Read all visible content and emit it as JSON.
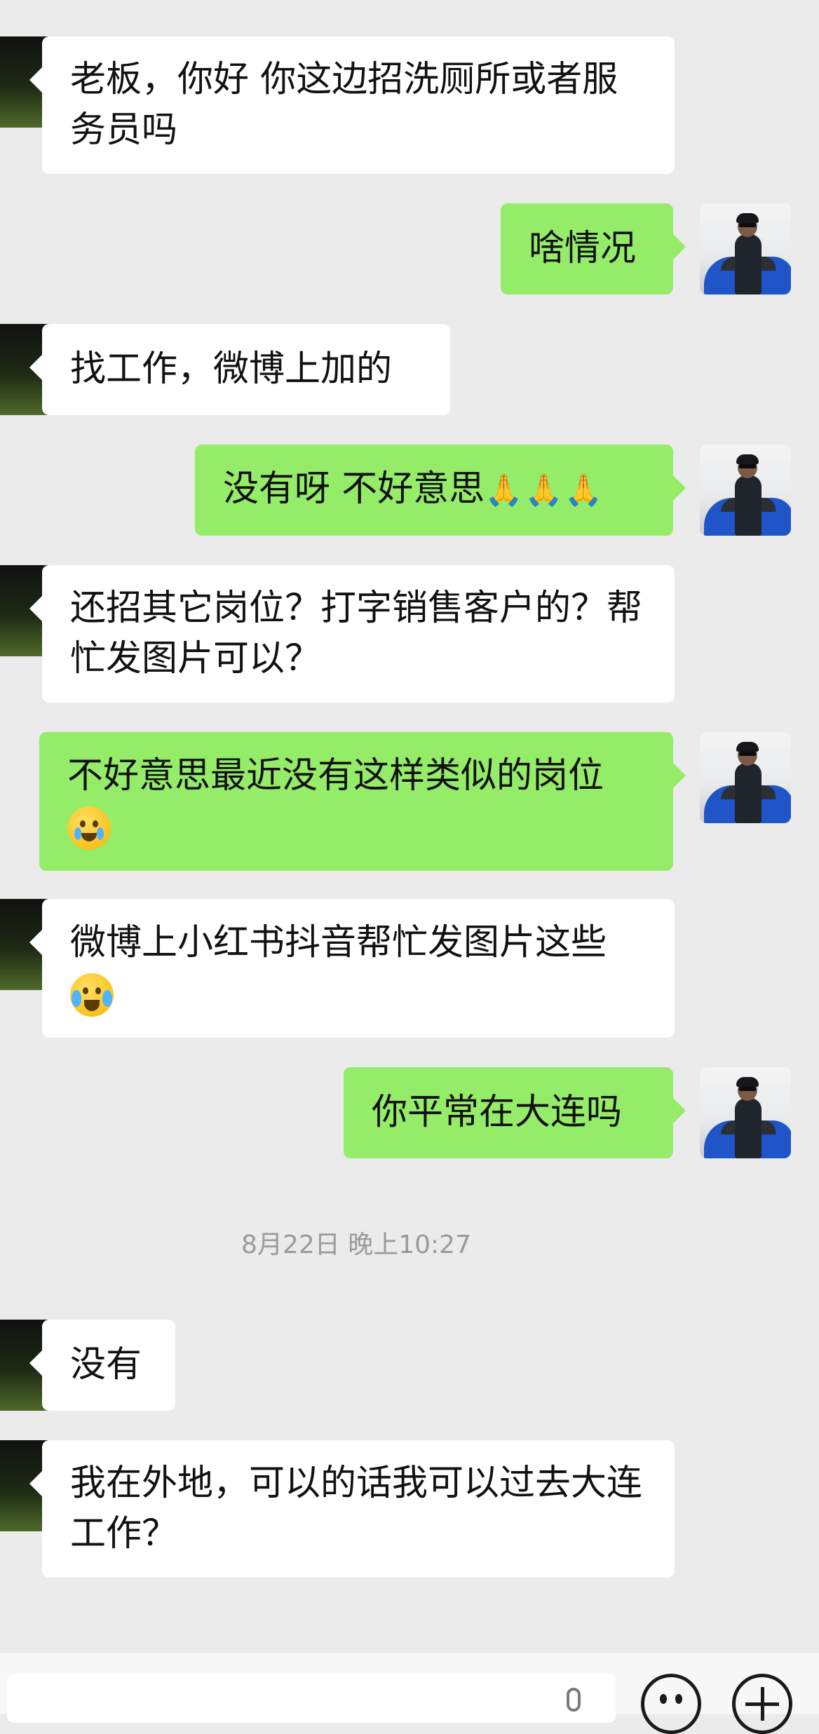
{
  "theme": {
    "background": "#ebebeb",
    "incoming_bubble": "#ffffff",
    "outgoing_bubble": "#95ec69"
  },
  "messages": [
    {
      "direction": "in",
      "text": "老板，你好 你这边招洗厕所或者服务员吗"
    },
    {
      "direction": "out",
      "text": "啥情况"
    },
    {
      "direction": "in",
      "text": "找工作，微博上加的"
    },
    {
      "direction": "out",
      "text": "没有呀 不好意思",
      "emoji": "folded-hands ×3"
    },
    {
      "direction": "in",
      "text": "还招其它岗位？打字销售客户的？帮忙发图片可以？"
    },
    {
      "direction": "out",
      "text": "不好意思最近没有这样类似的岗位",
      "emoji": "crying-face"
    },
    {
      "direction": "in",
      "text": "微博上小红书抖音帮忙发图片这些",
      "emoji": "loudly-crying-face"
    },
    {
      "direction": "out",
      "text": "你平常在大连吗"
    },
    {
      "direction": "time",
      "text": "8月22日 晚上10:27"
    },
    {
      "direction": "in",
      "text": "没有"
    },
    {
      "direction": "in",
      "text": "我在外地，可以的话我可以过去大连工作？"
    }
  ],
  "input_bar": {
    "icons": [
      "voice-clip-icon",
      "emoji-icon",
      "plus-icon"
    ]
  }
}
